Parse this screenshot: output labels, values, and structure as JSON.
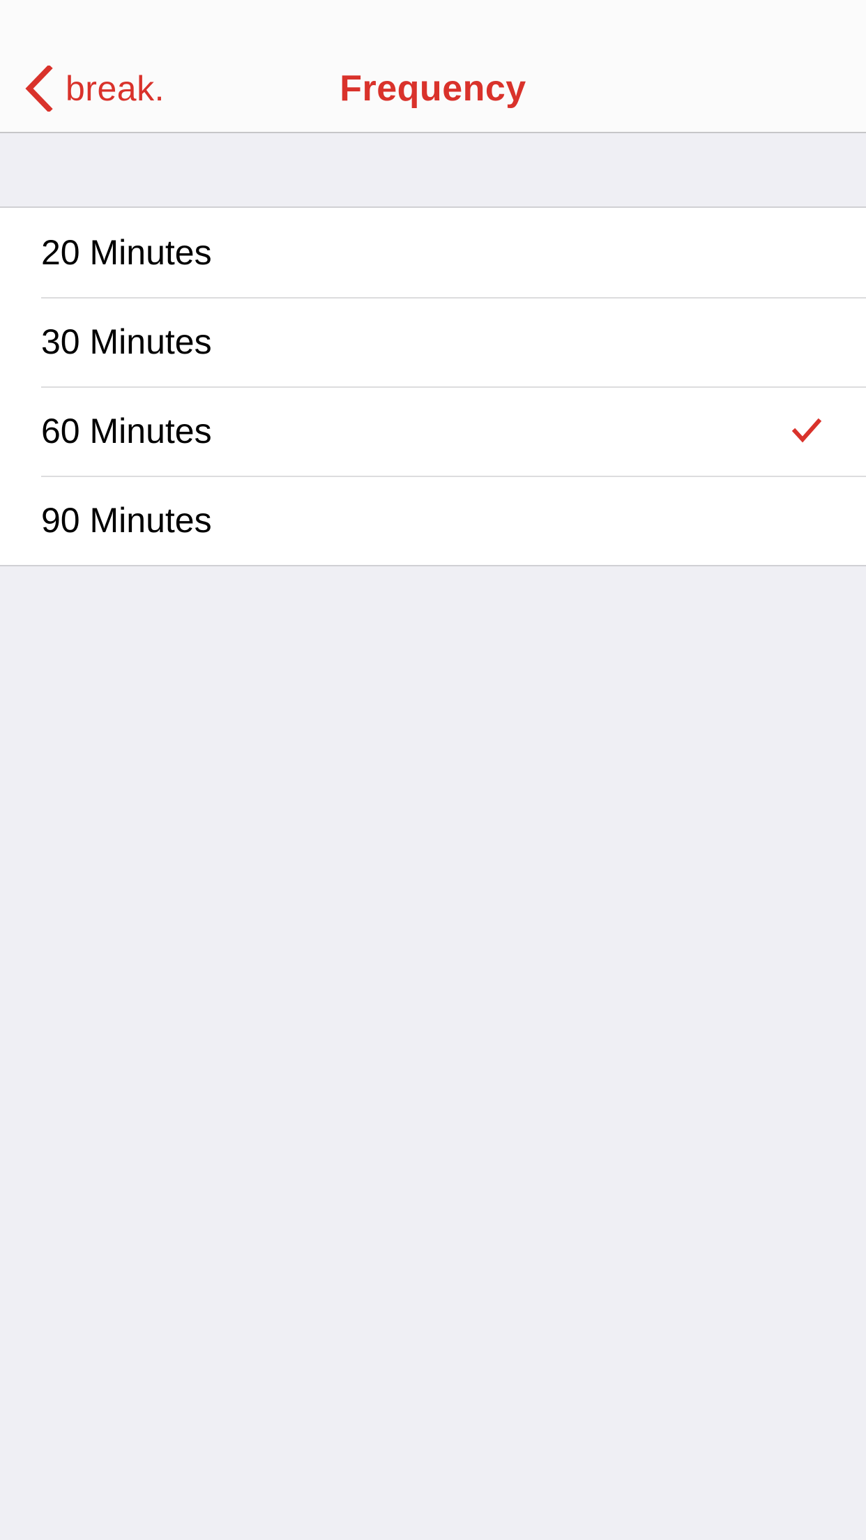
{
  "nav": {
    "back_label": "break.",
    "title": "Frequency"
  },
  "options": [
    {
      "label": "20 Minutes",
      "selected": false
    },
    {
      "label": "30 Minutes",
      "selected": false
    },
    {
      "label": "60 Minutes",
      "selected": true
    },
    {
      "label": "90 Minutes",
      "selected": false
    }
  ],
  "colors": {
    "accent": "#d9322b",
    "background": "#efeff4",
    "cell": "#ffffff"
  },
  "icons": {
    "back": "chevron-left-icon",
    "selected": "checkmark-icon"
  }
}
